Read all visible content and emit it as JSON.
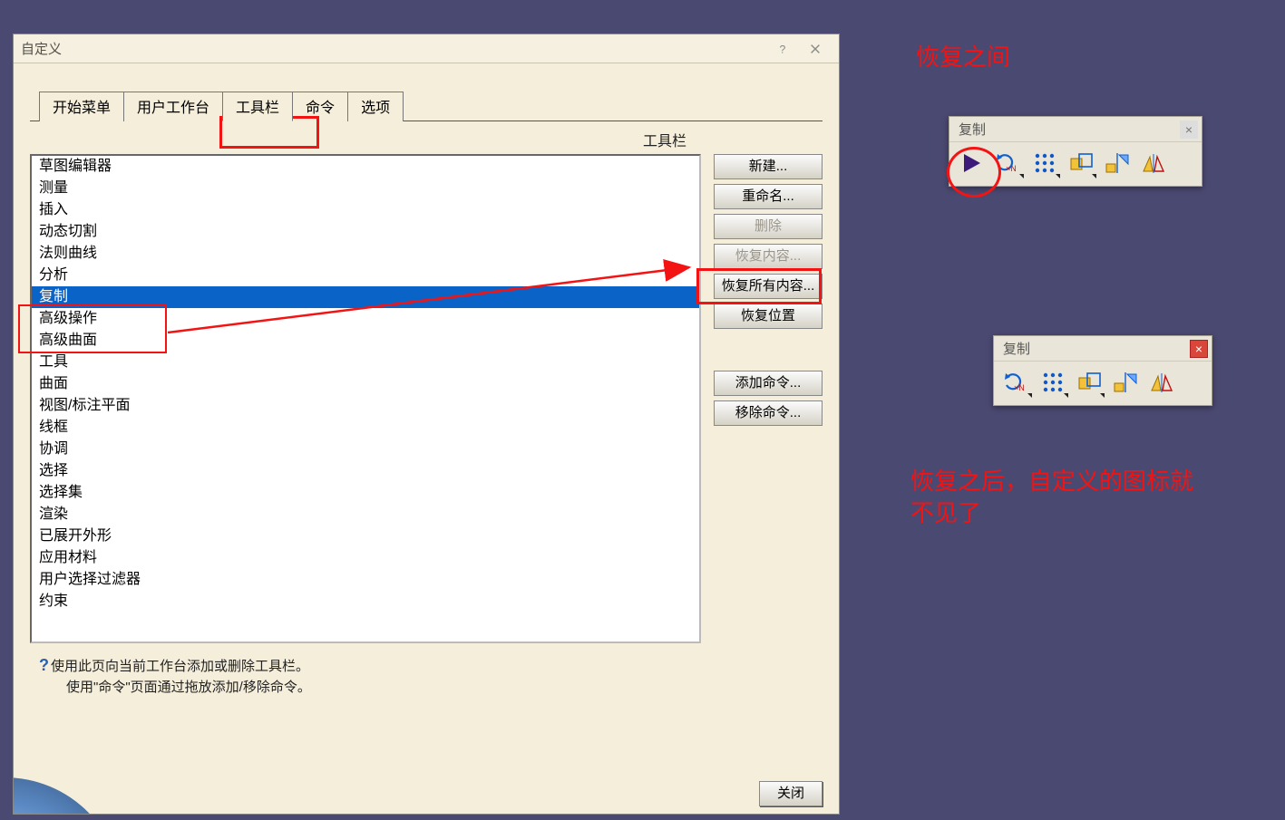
{
  "dialog": {
    "title": "自定义",
    "tabs": [
      "开始菜单",
      "用户工作台",
      "工具栏",
      "命令",
      "选项"
    ],
    "active_tab_index": 2,
    "section_label": "工具栏",
    "list_items": [
      "草图编辑器",
      "测量",
      "插入",
      "动态切割",
      "法则曲线",
      "分析",
      "复制",
      "高级操作",
      "高级曲面",
      "工具",
      "曲面",
      "视图/标注平面",
      "线框",
      "协调",
      "选择",
      "选择集",
      "渲染",
      "已展开外形",
      "应用材料",
      "用户选择过滤器",
      "约束"
    ],
    "selected_index": 6,
    "buttons": {
      "new": "新建...",
      "rename": "重命名...",
      "delete": "删除",
      "restore_content": "恢复内容...",
      "restore_all": "恢复所有内容...",
      "restore_pos": "恢复位置",
      "add_cmd": "添加命令...",
      "remove_cmd": "移除命令..."
    },
    "help1": "使用此页向当前工作台添加或删除工具栏。",
    "help2": "使用\"命令\"页面通过拖放添加/移除命令。",
    "close": "关闭"
  },
  "annotations": {
    "before_label": "恢复之间",
    "after_label": "恢复之后，自定义的图标就不见了"
  },
  "toolbar": {
    "title": "复制",
    "icons": [
      "play-icon",
      "repeat-xn-icon",
      "grid-pattern-icon",
      "scale-icon",
      "mirror-icon",
      "symmetry-icon"
    ]
  }
}
